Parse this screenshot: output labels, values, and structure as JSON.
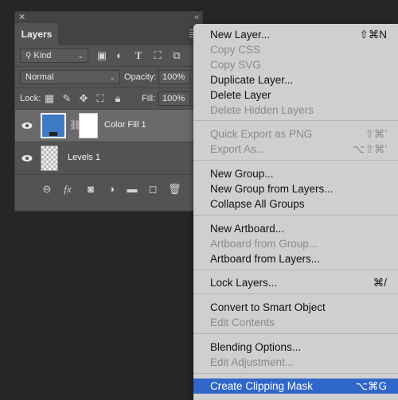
{
  "panel": {
    "tab_label": "Layers",
    "filter_kind": "Kind",
    "blend_mode": "Normal",
    "opacity_label": "Opacity:",
    "opacity_value": "100%",
    "lock_label": "Lock:",
    "fill_label": "Fill:",
    "fill_value": "100%",
    "layers": [
      {
        "name": "Color Fill 1",
        "selected": true
      },
      {
        "name": "Levels 1",
        "selected": false
      }
    ]
  },
  "menu": {
    "items": [
      {
        "label": "New Layer...",
        "shortcut": "⇧⌘N",
        "enabled": true
      },
      {
        "label": "Copy CSS",
        "shortcut": "",
        "enabled": false
      },
      {
        "label": "Copy SVG",
        "shortcut": "",
        "enabled": false
      },
      {
        "label": "Duplicate Layer...",
        "shortcut": "",
        "enabled": true
      },
      {
        "label": "Delete Layer",
        "shortcut": "",
        "enabled": true
      },
      {
        "label": "Delete Hidden Layers",
        "shortcut": "",
        "enabled": false
      },
      {
        "label": "Quick Export as PNG",
        "shortcut": "⇧⌘'",
        "enabled": false
      },
      {
        "label": "Export As...",
        "shortcut": "⌥⇧⌘'",
        "enabled": false
      },
      {
        "label": "New Group...",
        "shortcut": "",
        "enabled": true
      },
      {
        "label": "New Group from Layers...",
        "shortcut": "",
        "enabled": true
      },
      {
        "label": "Collapse All Groups",
        "shortcut": "",
        "enabled": true
      },
      {
        "label": "New Artboard...",
        "shortcut": "",
        "enabled": true
      },
      {
        "label": "Artboard from Group...",
        "shortcut": "",
        "enabled": false
      },
      {
        "label": "Artboard from Layers...",
        "shortcut": "",
        "enabled": true
      },
      {
        "label": "Lock Layers...",
        "shortcut": "⌘/",
        "enabled": true
      },
      {
        "label": "Convert to Smart Object",
        "shortcut": "",
        "enabled": true
      },
      {
        "label": "Edit Contents",
        "shortcut": "",
        "enabled": false
      },
      {
        "label": "Blending Options...",
        "shortcut": "",
        "enabled": true
      },
      {
        "label": "Edit Adjustment...",
        "shortcut": "",
        "enabled": false
      },
      {
        "label": "Create Clipping Mask",
        "shortcut": "⌥⌘G",
        "enabled": true,
        "highlighted": true
      }
    ]
  },
  "colors": {
    "highlight": "#2f66c9",
    "fill_thumb": "#3f7ac4"
  }
}
